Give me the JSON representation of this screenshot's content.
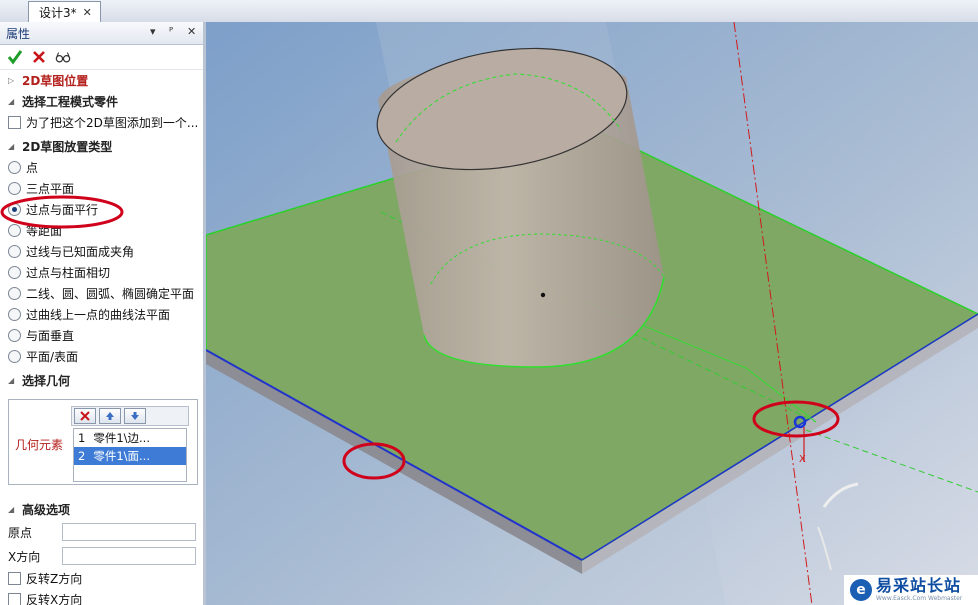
{
  "tabs": [
    {
      "label": "设计3*",
      "close": "✕"
    }
  ],
  "panel": {
    "title": "属性",
    "controls": {
      "pin": "ᴾ",
      "menu": "▾",
      "close": "✕"
    },
    "sections": {
      "sketch_position": "2D草图位置",
      "select_part": "选择工程模式零件",
      "placement_type": "2D草图放置类型",
      "select_geometry": "选择几何",
      "advanced": "高级选项"
    },
    "add_to_part_checkbox": "为了把这个2D草图添加到一个...",
    "placement_options": [
      "点",
      "三点平面",
      "过点与面平行",
      "等距面",
      "过线与已知面成夹角",
      "过点与柱面相切",
      "二线、圆、圆弧、椭圆确定平面",
      "过曲线上一点的曲线法平面",
      "与面垂直",
      "平面/表面"
    ],
    "selected_option_index": 2,
    "geometry": {
      "label": "几何元素",
      "items": [
        {
          "index": "1",
          "text": "零件1\\边..."
        },
        {
          "index": "2",
          "text": "零件1\\面..."
        }
      ],
      "selected_index": 1
    },
    "advanced_fields": {
      "origin_label": "原点",
      "x_dir_label": "X方向"
    },
    "flip_z": "反转Z方向",
    "flip_x": "反转X方向"
  },
  "watermark": {
    "main": "易采站长站",
    "sub": "Www.Easck.Com  Webmaster"
  },
  "colors": {
    "accent_red": "#d0021b",
    "plate_green": "#7fa864",
    "cylinder": "#b7aba1"
  }
}
